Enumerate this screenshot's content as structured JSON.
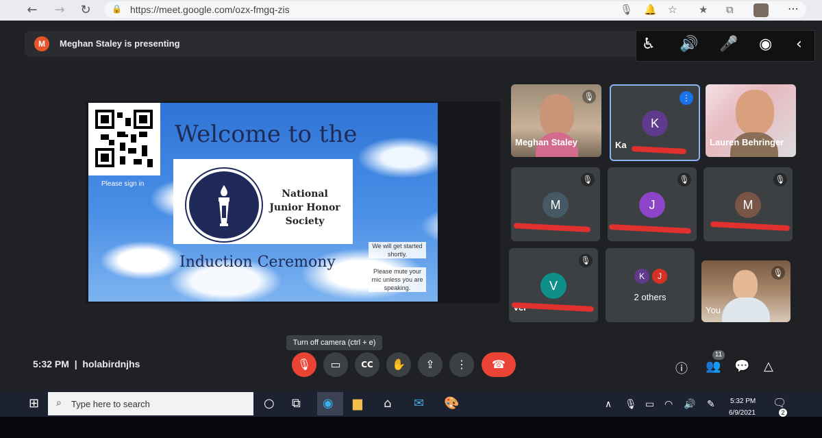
{
  "browser": {
    "url": "https://meet.google.com/ozx-fmgq-zis"
  },
  "presenting": {
    "avatar_letter": "M",
    "text": "Meghan Staley is presenting"
  },
  "slide": {
    "welcome": "Welcome to the",
    "org_name": "National Junior Honor Society",
    "ceremony": "Induction Ceremony",
    "signin": "Please sign in",
    "note1": "We will get started shortly.",
    "note2": "Please mute your mic unless you are speaking."
  },
  "participants": [
    {
      "name": "Meghan Staley"
    },
    {
      "letter": "K",
      "name": "Ka"
    },
    {
      "name": "Lauren Behringer"
    },
    {
      "letter": "M"
    },
    {
      "letter": "J"
    },
    {
      "letter": "M"
    },
    {
      "letter": "V",
      "name": "Ver"
    },
    {
      "letters": [
        "K",
        "J"
      ],
      "name": "2 others"
    },
    {
      "name": "You"
    }
  ],
  "colors": {
    "avatar_k": "#5f3a8d",
    "avatar_m1": "#455a64",
    "avatar_j": "#8e44c9",
    "avatar_m2": "#795548",
    "avatar_v": "#0f8f8a",
    "end_call": "#ea4335"
  },
  "controls": {
    "tooltip": "Turn off camera (ctrl + e)",
    "time": "5:32 PM",
    "meeting_code": "holabirdnjhs",
    "participants_count": "11"
  },
  "taskbar": {
    "search_placeholder": "Type here to search",
    "time": "5:32 PM",
    "date": "6/9/2021",
    "notifications": "2"
  }
}
